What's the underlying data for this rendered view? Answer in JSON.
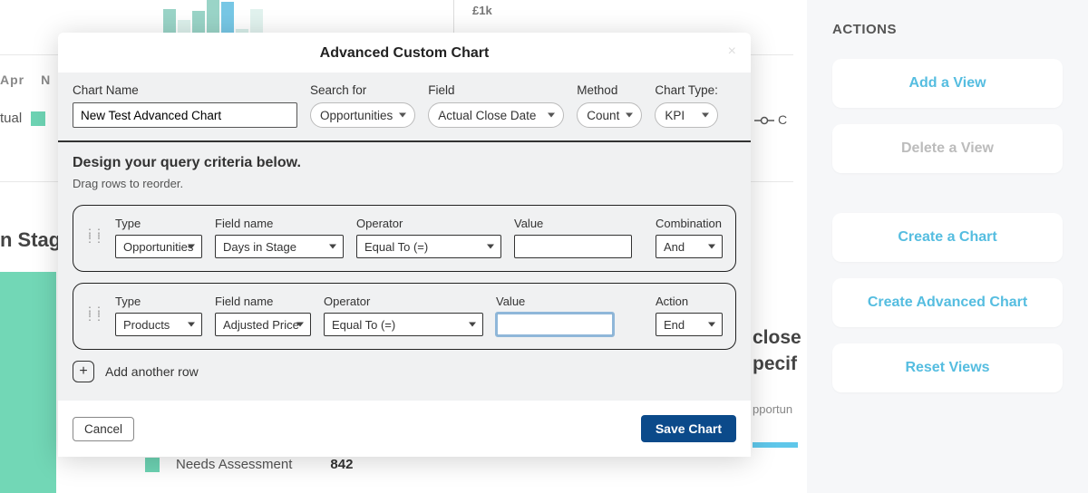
{
  "background": {
    "k1": "£1k",
    "months": [
      "Apr",
      "N"
    ],
    "tual": "tual",
    "circle": "C",
    "stag": "n Stag",
    "needs_label": "Needs Assessment",
    "needs_value": "842",
    "close_line1": "close",
    "close_line2": "pecif",
    "opp": "pportun"
  },
  "actions": {
    "heading": "ACTIONS",
    "add_view": "Add a View",
    "delete_view": "Delete a View",
    "create_chart": "Create a Chart",
    "create_adv_chart": "Create Advanced Chart",
    "reset_views": "Reset Views"
  },
  "modal": {
    "title": "Advanced Custom Chart",
    "chart_name_label": "Chart Name",
    "chart_name_value": "New Test Advanced Chart",
    "search_for_label": "Search for",
    "search_for_value": "Opportunities",
    "field_label": "Field",
    "field_value": "Actual Close Date",
    "method_label": "Method",
    "method_value": "Count",
    "chart_type_label": "Chart Type:",
    "chart_type_value": "KPI",
    "design_title": "Design your query criteria below.",
    "design_sub": "Drag rows to reorder.",
    "labels": {
      "type": "Type",
      "field_name": "Field name",
      "operator": "Operator",
      "value": "Value",
      "combination": "Combination",
      "action": "Action"
    },
    "rows": [
      {
        "type": "Opportunities",
        "field_name": "Days in Stage",
        "operator": "Equal To (=)",
        "value": "",
        "combo": "And"
      },
      {
        "type": "Products",
        "field_name": "Adjusted Price",
        "operator": "Equal To (=)",
        "value": "",
        "combo": "End"
      }
    ],
    "add_row": "Add another row",
    "cancel": "Cancel",
    "save": "Save Chart"
  }
}
